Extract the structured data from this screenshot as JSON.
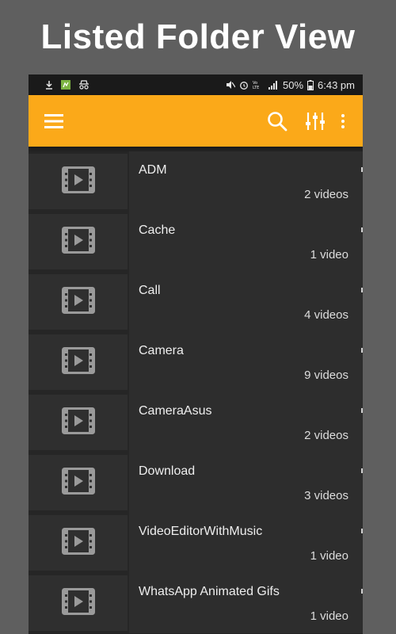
{
  "banner": {
    "title": "Listed Folder View"
  },
  "statusbar": {
    "battery": "50%",
    "time": "6:43 pm"
  },
  "appbar": {
    "menu_icon": "hamburger-menu-icon",
    "search_icon": "search-icon",
    "filter_icon": "equalizer-filter-icon",
    "overflow_icon": "more-vert-icon",
    "accent_color": "#fba919"
  },
  "folders": [
    {
      "name": "ADM",
      "count": "2 videos"
    },
    {
      "name": "Cache",
      "count": "1 video"
    },
    {
      "name": "Call",
      "count": "4 videos"
    },
    {
      "name": "Camera",
      "count": "9 videos"
    },
    {
      "name": "CameraAsus",
      "count": "2 videos"
    },
    {
      "name": "Download",
      "count": "3 videos"
    },
    {
      "name": "VideoEditorWithMusic",
      "count": "1 video"
    },
    {
      "name": "WhatsApp Animated Gifs",
      "count": "1 video"
    }
  ]
}
